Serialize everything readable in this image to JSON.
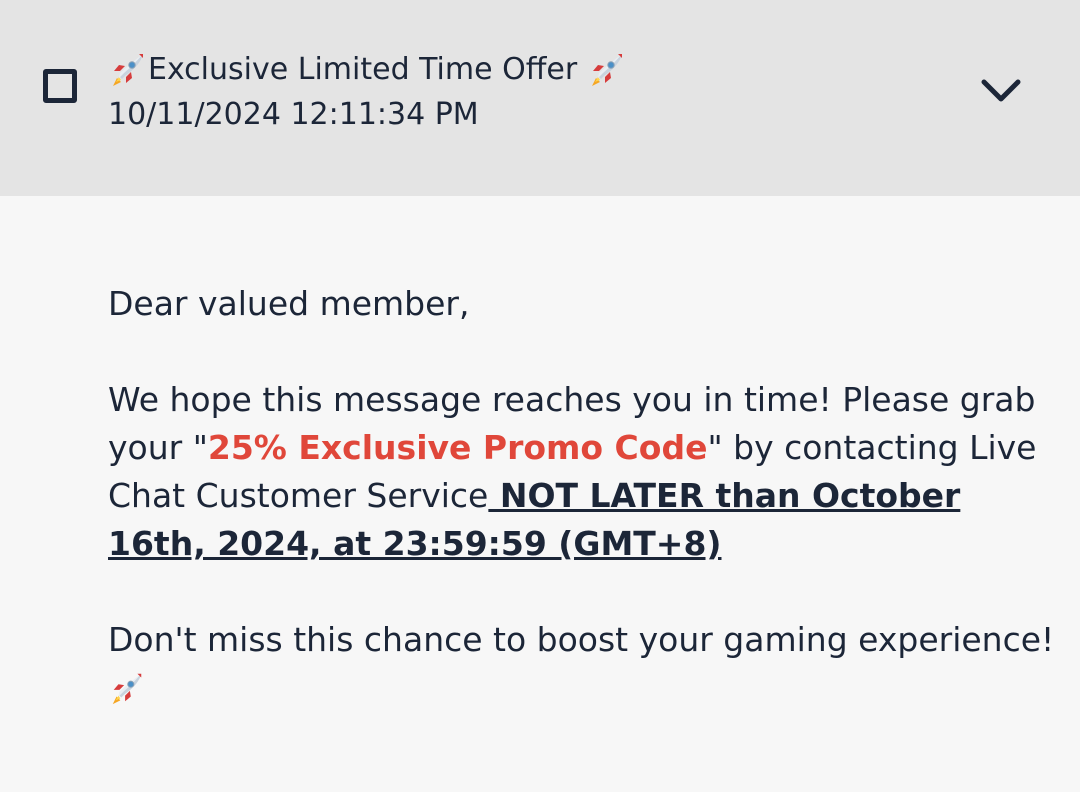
{
  "message": {
    "title": "Exclusive Limited Time Offer",
    "timestamp": "10/11/2024 12:11:34 PM",
    "title_icon": "rocket-icon",
    "expand_icon": "chevron-down-icon",
    "selected": false
  },
  "body": {
    "greeting": "Dear valued member,",
    "para1_part1": "We hope this message reaches you in time! Please grab your \"",
    "promo": "25% Exclusive Promo Code",
    "para1_part2": "\" by contacting Live Chat Customer Service",
    "deadline": " NOT LATER than October 16th, 2024, at 23:59:59 (GMT+8)",
    "para2": "Don't miss this chance to boost your gaming experience!",
    "promo_color": "#e0473a"
  }
}
